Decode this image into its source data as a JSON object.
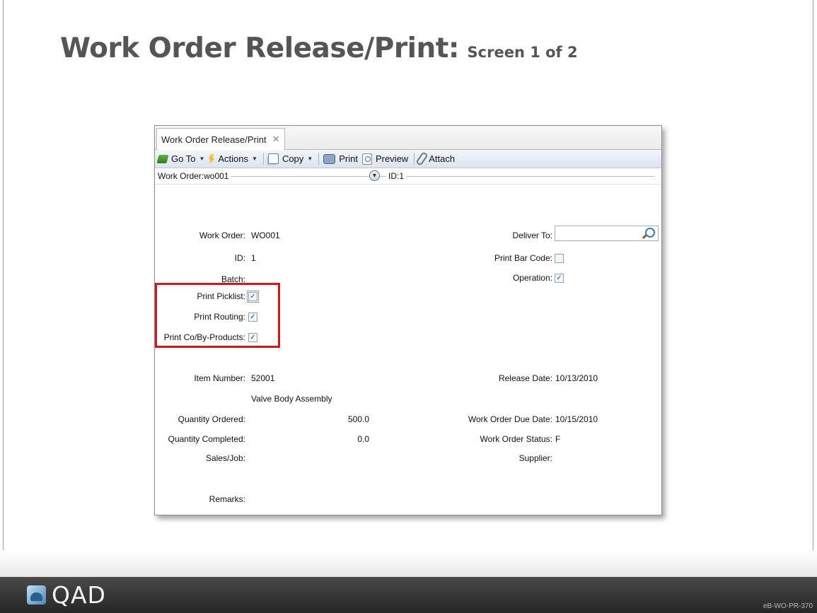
{
  "slide": {
    "title_main": "Work Order Release/Print:",
    "title_sub": "Screen 1 of 2",
    "logo_text": "QAD",
    "code": "eB-WO-PR-370"
  },
  "window": {
    "tab_label": "Work Order Release/Print",
    "tab_close": "✕",
    "toolbar": {
      "goto": "Go To",
      "actions": "Actions",
      "copy": "Copy",
      "print": "Print",
      "preview": "Preview",
      "attach": "Attach",
      "arrow": "▼"
    },
    "header": {
      "work_order": "Work Order:wo001",
      "id": "ID:1"
    },
    "form": {
      "work_order_label": "Work Order:",
      "work_order_value": "WO001",
      "id_label": "ID:",
      "id_value": "1",
      "batch_label": "Batch:",
      "print_picklist_label": "Print Picklist:",
      "print_routing_label": "Print Routing:",
      "print_coby_label": "Print Co/By-Products:",
      "deliver_to_label": "Deliver To:",
      "deliver_to_value": "",
      "print_barcode_label": "Print Bar Code:",
      "operation_label": "Operation:",
      "item_number_label": "Item Number:",
      "item_number_value": "52001",
      "item_description": "Valve Body Assembly",
      "qty_ordered_label": "Quantity Ordered:",
      "qty_ordered_value": "500.0",
      "qty_completed_label": "Quantity Completed:",
      "qty_completed_value": "0.0",
      "sales_job_label": "Sales/Job:",
      "remarks_label": "Remarks:",
      "release_date_label": "Release Date:",
      "release_date_value": "10/13/2010",
      "due_date_label": "Work Order Due Date:",
      "due_date_value": "10/15/2010",
      "status_label": "Work Order Status:",
      "status_value": "F",
      "supplier_label": "Supplier:",
      "check": "✓"
    },
    "checkboxes": {
      "print_picklist": true,
      "print_routing": true,
      "print_coby": true,
      "print_barcode": false,
      "operation": true
    }
  }
}
